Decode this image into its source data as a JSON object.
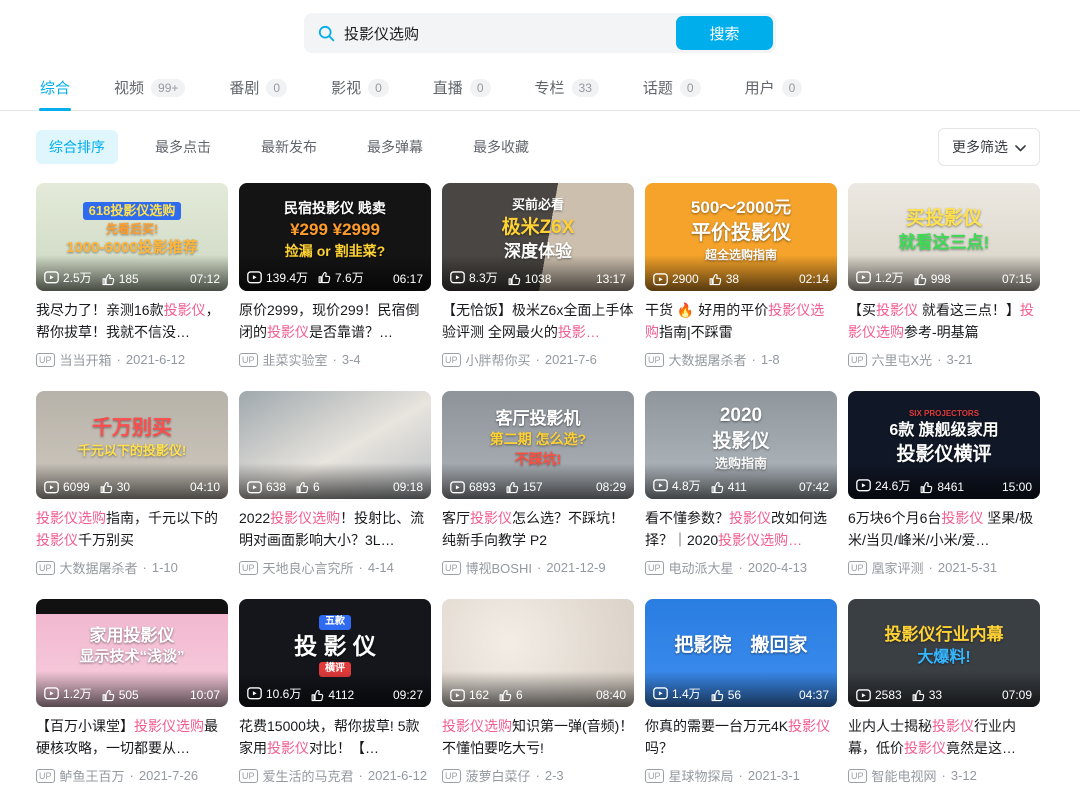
{
  "colors": {
    "accent": "#00aeec",
    "keyword_highlight": "#f25d8e"
  },
  "search": {
    "value": "投影仪选购",
    "button_label": "搜索"
  },
  "tabs": {
    "items": [
      {
        "label": "综合",
        "count": "",
        "active": true
      },
      {
        "label": "视频",
        "count": "99+",
        "active": false
      },
      {
        "label": "番剧",
        "count": "0",
        "active": false
      },
      {
        "label": "影视",
        "count": "0",
        "active": false
      },
      {
        "label": "直播",
        "count": "0",
        "active": false
      },
      {
        "label": "专栏",
        "count": "33",
        "active": false
      },
      {
        "label": "话题",
        "count": "0",
        "active": false
      },
      {
        "label": "用户",
        "count": "0",
        "active": false
      }
    ]
  },
  "filters": {
    "items": [
      {
        "label": "综合排序",
        "active": true
      },
      {
        "label": "最多点击",
        "active": false
      },
      {
        "label": "最新发布",
        "active": false
      },
      {
        "label": "最多弹幕",
        "active": false
      },
      {
        "label": "最多收藏",
        "active": false
      }
    ],
    "more_label": "更多筛选"
  },
  "uploader_badge": "UP",
  "cards": [
    {
      "views": "2.5万",
      "likes": "185",
      "duration": "07:12",
      "title": [
        {
          "t": "我尽力了！亲测16款"
        },
        {
          "t": "投影仪",
          "hl": true
        },
        {
          "t": "，帮你拔草！我就不信没…"
        }
      ],
      "uploader": "当当开箱",
      "date": "2021-6-12",
      "thumb": {
        "bg": "linear-gradient(180deg,#e3ead9,#cdd8c2)",
        "lines": [
          {
            "text": "618投影仪选购",
            "color": "#ffe14d",
            "bg": "#2f6bf0",
            "size": 13
          },
          {
            "text": "先看后买!",
            "color": "#ff9c2a",
            "size": 12
          },
          {
            "text": "1000-6000投影推荐",
            "color": "#ffb53a",
            "size": 15
          }
        ]
      }
    },
    {
      "views": "139.4万",
      "likes": "7.6万",
      "duration": "06:17",
      "title": [
        {
          "t": "原价2999，现价299！民宿倒闭的"
        },
        {
          "t": "投影仪",
          "hl": true
        },
        {
          "t": "是否靠谱？…"
        }
      ],
      "uploader": "韭菜实验室",
      "date": "3-4",
      "thumb": {
        "bg": "#141414",
        "lines": [
          {
            "text": "民宿投影仪 贱卖",
            "color": "#ffffff",
            "size": 14
          },
          {
            "text": "¥299  ¥2999",
            "color": "#ff9c2a",
            "size": 17
          },
          {
            "text": "捡漏 or 割韭菜?",
            "color": "#ffd234",
            "size": 14
          }
        ]
      }
    },
    {
      "views": "8.3万",
      "likes": "1038",
      "duration": "13:17",
      "title": [
        {
          "t": "【无恰饭】极米Z6x全面上手体验评测 全网最火的"
        },
        {
          "t": "投影…",
          "hl": true
        }
      ],
      "uploader": "小胖帮你买",
      "date": "2021-7-6",
      "thumb": {
        "bg": "linear-gradient(100deg,#4a4643 55%,#cdbfae 55%)",
        "lines": [
          {
            "text": "买前必看",
            "color": "#ffffff",
            "size": 13
          },
          {
            "text": "极米Z6X",
            "color": "#ffd234",
            "size": 19
          },
          {
            "text": "深度体验",
            "color": "#ffffff",
            "size": 17
          }
        ]
      }
    },
    {
      "views": "2900",
      "likes": "38",
      "duration": "02:14",
      "title": [
        {
          "t": "干货 🔥 好用的平价"
        },
        {
          "t": "投影仪选购",
          "hl": true
        },
        {
          "t": "指南|不踩雷"
        }
      ],
      "uploader": "大数据屠杀者",
      "date": "1-8",
      "thumb": {
        "bg": "#f5a32a",
        "lines": [
          {
            "text": "500～2000元",
            "color": "#ffffff",
            "size": 17
          },
          {
            "text": "平价投影仪",
            "color": "#ffffff",
            "size": 20
          },
          {
            "text": "超全选购指南",
            "color": "#ffffff",
            "size": 12
          }
        ]
      }
    },
    {
      "views": "1.2万",
      "likes": "998",
      "duration": "07:15",
      "title": [
        {
          "t": "【买"
        },
        {
          "t": "投影仪",
          "hl": true
        },
        {
          "t": " 就看这三点！】"
        },
        {
          "t": "投影仪选购",
          "hl": true
        },
        {
          "t": "参考-明基篇"
        }
      ],
      "uploader": "六里屯X光",
      "date": "3-21",
      "thumb": {
        "bg": "linear-gradient(180deg,#ece9e2,#d8d2c6)",
        "lines": [
          {
            "text": "买投影仪",
            "color": "#ffe14d",
            "size": 19
          },
          {
            "text": "就看这三点!",
            "color": "#3ddb55",
            "size": 17
          }
        ]
      }
    },
    {
      "views": "6099",
      "likes": "30",
      "duration": "04:10",
      "title": [
        {
          "t": "投影仪选购",
          "hl": true
        },
        {
          "t": "指南，千元以下的"
        },
        {
          "t": "投影仪",
          "hl": true
        },
        {
          "t": "千万别买"
        }
      ],
      "uploader": "大数据屠杀者",
      "date": "1-10",
      "thumb": {
        "bg": "linear-gradient(180deg,#b7b2a9,#cfc9bf)",
        "lines": [
          {
            "text": "千万别买",
            "color": "#ff4d4d",
            "size": 20
          },
          {
            "text": "千元以下的投影仪!",
            "color": "#ffe14d",
            "size": 13
          }
        ]
      }
    },
    {
      "views": "638",
      "likes": "6",
      "duration": "09:18",
      "title": [
        {
          "t": "2022"
        },
        {
          "t": "投影仪选购",
          "hl": true
        },
        {
          "t": "！投射比、流明对画面影响大小？3L…"
        }
      ],
      "uploader": "天地良心言究所",
      "date": "4-14",
      "thumb": {
        "bg": "linear-gradient(150deg,#9fa8ad,#e8e4de 55%,#b9bec2)",
        "lines": []
      }
    },
    {
      "views": "6893",
      "likes": "157",
      "duration": "08:29",
      "title": [
        {
          "t": "客厅"
        },
        {
          "t": "投影仪",
          "hl": true
        },
        {
          "t": "怎么选？不踩坑！纯新手向教学 P2"
        }
      ],
      "uploader": "博视BOSHI",
      "date": "2021-12-9",
      "thumb": {
        "bg": "linear-gradient(180deg,#8d9399,#aeb4ba)",
        "lines": [
          {
            "text": "客厅投影机",
            "color": "#ffffff",
            "size": 17
          },
          {
            "text": "第二期 怎么选?",
            "color": "#ffd234",
            "size": 14
          },
          {
            "text": "不踩坑!",
            "color": "#ff4f3f",
            "size": 14
          }
        ]
      }
    },
    {
      "views": "4.8万",
      "likes": "411",
      "duration": "07:42",
      "title": [
        {
          "t": "看不懂参数？"
        },
        {
          "t": "投影仪",
          "hl": true
        },
        {
          "t": "改如何选择？｜2020"
        },
        {
          "t": "投影仪选购…",
          "hl": true
        }
      ],
      "uploader": "电动派大星",
      "date": "2020-4-13",
      "thumb": {
        "bg": "linear-gradient(180deg,#8f969c,#b4bcc2)",
        "lines": [
          {
            "text": "2020",
            "color": "#ffffff",
            "size": 19
          },
          {
            "text": "投影仪",
            "color": "#ffffff",
            "size": 19
          },
          {
            "text": "选购指南",
            "color": "#ffffff",
            "size": 13
          }
        ]
      }
    },
    {
      "views": "24.6万",
      "likes": "8461",
      "duration": "15:00",
      "title": [
        {
          "t": "6万块6个月6台"
        },
        {
          "t": "投影仪",
          "hl": true
        },
        {
          "t": " 坚果/极米/当贝/峰米/小米/爱…"
        }
      ],
      "uploader": "凰家评测",
      "date": "2021-5-31",
      "thumb": {
        "bg": "#101726",
        "lines": [
          {
            "text": "SIX PROJECTORS",
            "color": "#e03a3a",
            "size": 8
          },
          {
            "text": "6款 旗舰级家用",
            "color": "#ffffff",
            "size": 16
          },
          {
            "text": "投影仪横评",
            "color": "#ffffff",
            "size": 19
          }
        ]
      }
    },
    {
      "views": "1.2万",
      "likes": "505",
      "duration": "10:07",
      "title": [
        {
          "t": "【百万小课堂】"
        },
        {
          "t": "投影仪选购",
          "hl": true
        },
        {
          "t": "最硬核攻略，一切都要从…"
        }
      ],
      "uploader": "鲈鱼王百万",
      "date": "2021-7-26",
      "thumb": {
        "bg": "linear-gradient(180deg,#111 0%,#111 14%,#f2b8cf 14%,#f7cfdf 100%)",
        "lines": [
          {
            "text": "家用投影仪",
            "color": "#ffffff",
            "size": 17
          },
          {
            "text": "显示技术“浅谈”",
            "color": "#ffffff",
            "size": 15
          }
        ]
      }
    },
    {
      "views": "10.6万",
      "likes": "4112",
      "duration": "09:27",
      "title": [
        {
          "t": "花费15000块，帮你拔草! 5款家用"
        },
        {
          "t": "投影仪",
          "hl": true
        },
        {
          "t": "对比！【…"
        }
      ],
      "uploader": "爱生活的马克君",
      "date": "2021-6-12",
      "thumb": {
        "bg": "#14161c",
        "lines": [
          {
            "text": "五款",
            "color": "#ffffff",
            "bg": "#2f6bf0",
            "size": 10
          },
          {
            "text": "投 影 仪",
            "color": "#ffffff",
            "size": 23
          },
          {
            "text": "横评",
            "color": "#ffffff",
            "bg": "#e03a3a",
            "size": 10
          }
        ]
      }
    },
    {
      "views": "162",
      "likes": "6",
      "duration": "08:40",
      "title": [
        {
          "t": "投影仪选购",
          "hl": true
        },
        {
          "t": "知识第一弹(音频)！不懂怕要吃大亏!"
        }
      ],
      "uploader": "菠萝白菜仔",
      "date": "2-3",
      "thumb": {
        "bg": "radial-gradient(circle at 35% 40%,#f3ede6,#d9d0c6)",
        "lines": []
      }
    },
    {
      "views": "1.4万",
      "likes": "56",
      "duration": "04:37",
      "title": [
        {
          "t": "你真的需要一台万元4K"
        },
        {
          "t": "投影仪",
          "hl": true
        },
        {
          "t": "吗？"
        }
      ],
      "uploader": "星球物探局",
      "date": "2021-3-1",
      "thumb": {
        "bg": "linear-gradient(180deg,#2a7de1,#3f8ef0)",
        "lines": [
          {
            "text": "把影院　搬回家",
            "color": "#ffffff",
            "size": 19
          }
        ]
      }
    },
    {
      "views": "2583",
      "likes": "33",
      "duration": "07:09",
      "title": [
        {
          "t": "业内人士揭秘"
        },
        {
          "t": "投影仪",
          "hl": true
        },
        {
          "t": "行业内幕，低价"
        },
        {
          "t": "投影仪",
          "hl": true
        },
        {
          "t": "竟然是这…"
        }
      ],
      "uploader": "智能电视网",
      "date": "3-12",
      "thumb": {
        "bg": "#3a3f44",
        "lines": [
          {
            "text": "投影仪行业内幕",
            "color": "#ffd234",
            "size": 17
          },
          {
            "text": "大爆料!",
            "color": "#35b6ff",
            "size": 16
          }
        ]
      }
    }
  ]
}
